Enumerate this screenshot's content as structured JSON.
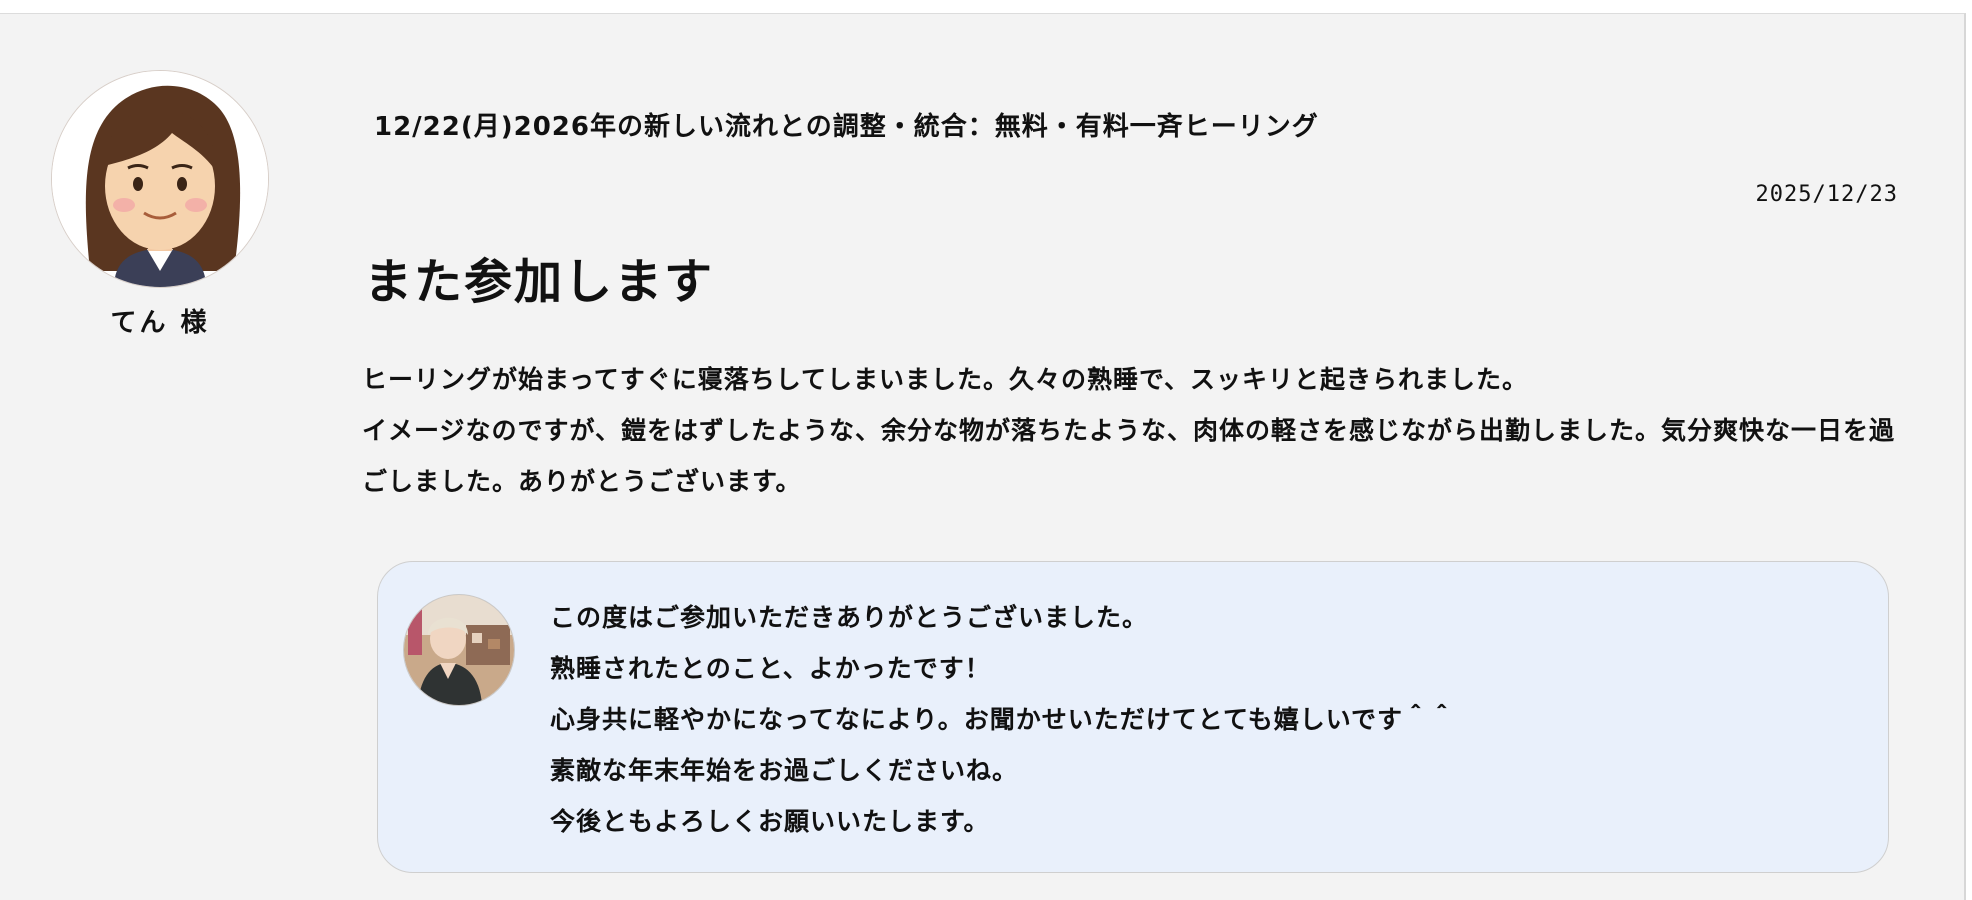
{
  "reviewer": {
    "name": "てん 様"
  },
  "event": {
    "title": "12/22(月)2026年の新しい流れとの調整・統合：無料・有料一斉ヒーリング"
  },
  "review": {
    "date": "2025/12/23",
    "title": "また参加します",
    "paragraphs": [
      "ヒーリングが始まってすぐに寝落ちしてしまいました。久々の熟睡で、スッキリと起きられました。",
      "イメージなのですが、鎧をはずしたような、余分な物が落ちたような、肉体の軽さを感じながら出勤しました。気分爽快な一日を過ごしました。ありがとうございます。"
    ]
  },
  "reply": {
    "lines": [
      "この度はご参加いただきありがとうございました。",
      "熟睡されたとのこと、よかったです！",
      "心身共に軽やかになってなにより。お聞かせいただけてとても嬉しいです＾＾",
      "素敵な年末年始をお過ごしくださいね。",
      "今後ともよろしくお願いいたします。"
    ]
  },
  "colors": {
    "page_background": "#f3f3f3",
    "reply_background": "#e9f0fb",
    "text": "#111111"
  },
  "icons": {
    "reviewer_avatar": "woman-avatar-icon",
    "host_avatar": "host-photo-avatar"
  }
}
